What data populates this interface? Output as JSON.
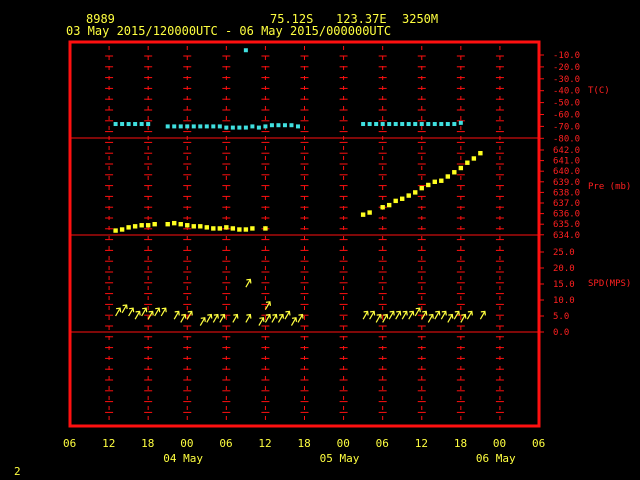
{
  "header": {
    "station_id": "8989",
    "lat": "75.12S",
    "lon": "123.37E",
    "elev": "3250M",
    "time_range": "03 May 2015/120000UTC - 06 May 2015/000000UTC"
  },
  "footer": {
    "page_number": "2"
  },
  "colors": {
    "frame": "#ff1010",
    "grid": "#ff1010",
    "text": "#ffff40",
    "temp": "#40e0e0",
    "pres": "#ffff20",
    "wind": "#ffff40"
  },
  "chart_data": {
    "type": "scatter",
    "x_axis": {
      "unit": "hours since 03 May 2015 00 UTC",
      "range": [
        6,
        78
      ],
      "tick_labels": [
        "06",
        "12",
        "18",
        "00",
        "06",
        "12",
        "18",
        "00",
        "06",
        "12",
        "18",
        "00",
        "06"
      ],
      "date_labels": [
        {
          "label": "04 May",
          "x": 24
        },
        {
          "label": "05 May",
          "x": 48
        },
        {
          "label": "06 May",
          "x": 72
        }
      ]
    },
    "panels": [
      {
        "name": "temperature",
        "label": "T(C)",
        "ticks": [
          "-10.0",
          "-20.0",
          "-30.0",
          "-40.0",
          "-50.0",
          "-60.0",
          "-70.0",
          "-80.0"
        ],
        "range": [
          -85,
          -5
        ],
        "points": [
          [
            13,
            -68
          ],
          [
            14,
            -68
          ],
          [
            15,
            -68
          ],
          [
            16,
            -68
          ],
          [
            17,
            -68
          ],
          [
            18,
            -68
          ],
          [
            21,
            -70
          ],
          [
            22,
            -70
          ],
          [
            23,
            -70
          ],
          [
            24,
            -70
          ],
          [
            25,
            -70
          ],
          [
            26,
            -70
          ],
          [
            27,
            -70
          ],
          [
            28,
            -70
          ],
          [
            29,
            -70
          ],
          [
            30,
            -71
          ],
          [
            31,
            -71
          ],
          [
            32,
            -71
          ],
          [
            33,
            -71
          ],
          [
            34,
            -70
          ],
          [
            35,
            -71
          ],
          [
            36,
            -70
          ],
          [
            37,
            -69
          ],
          [
            38,
            -69
          ],
          [
            39,
            -69
          ],
          [
            40,
            -69
          ],
          [
            41,
            -70
          ],
          [
            33,
            -6
          ],
          [
            51,
            -68
          ],
          [
            52,
            -68
          ],
          [
            53,
            -68
          ],
          [
            54,
            -68
          ],
          [
            55,
            -68
          ],
          [
            56,
            -68
          ],
          [
            57,
            -68
          ],
          [
            58,
            -68
          ],
          [
            59,
            -68
          ],
          [
            60,
            -68
          ],
          [
            61,
            -68
          ],
          [
            62,
            -68
          ],
          [
            63,
            -68
          ],
          [
            64,
            -68
          ],
          [
            65,
            -68
          ],
          [
            66,
            -67
          ]
        ]
      },
      {
        "name": "pressure",
        "label": "Pre (mb)",
        "ticks": [
          "642.0",
          "641.0",
          "640.0",
          "639.0",
          "638.0",
          "637.0",
          "636.0",
          "635.0",
          "634.0"
        ],
        "range": [
          634,
          642
        ],
        "points": [
          [
            13,
            634.4
          ],
          [
            14,
            634.5
          ],
          [
            15,
            634.7
          ],
          [
            16,
            634.8
          ],
          [
            17,
            634.9
          ],
          [
            18,
            634.9
          ],
          [
            19,
            635.0
          ],
          [
            21,
            635.0
          ],
          [
            22,
            635.1
          ],
          [
            23,
            635.0
          ],
          [
            24,
            634.9
          ],
          [
            25,
            634.8
          ],
          [
            26,
            634.8
          ],
          [
            27,
            634.7
          ],
          [
            28,
            634.6
          ],
          [
            29,
            634.6
          ],
          [
            30,
            634.7
          ],
          [
            31,
            634.6
          ],
          [
            32,
            634.5
          ],
          [
            33,
            634.5
          ],
          [
            34,
            634.6
          ],
          [
            36,
            634.6
          ],
          [
            51,
            635.9
          ],
          [
            52,
            636.1
          ],
          [
            54,
            636.6
          ],
          [
            55,
            636.8
          ],
          [
            56,
            637.2
          ],
          [
            57,
            637.4
          ],
          [
            58,
            637.7
          ],
          [
            59,
            638.0
          ],
          [
            60,
            638.4
          ],
          [
            61,
            638.7
          ],
          [
            62,
            639.0
          ],
          [
            63,
            639.1
          ],
          [
            64,
            639.5
          ],
          [
            65,
            639.9
          ],
          [
            66,
            640.3
          ],
          [
            67,
            640.8
          ],
          [
            68,
            641.2
          ],
          [
            69,
            641.7
          ]
        ]
      },
      {
        "name": "wind",
        "label": "SPD(MPS)",
        "ticks": [
          "25.0",
          "20.0",
          "15.0",
          "10.0",
          "5.0",
          "0.0"
        ],
        "range": [
          0,
          26
        ],
        "points": [
          [
            13,
            5
          ],
          [
            14,
            6
          ],
          [
            15,
            5
          ],
          [
            16,
            4
          ],
          [
            17,
            5
          ],
          [
            18,
            4
          ],
          [
            19,
            5
          ],
          [
            20,
            5
          ],
          [
            22,
            4
          ],
          [
            23,
            3
          ],
          [
            24,
            4
          ],
          [
            26,
            2
          ],
          [
            27,
            3
          ],
          [
            28,
            3
          ],
          [
            29,
            3
          ],
          [
            31,
            3
          ],
          [
            33,
            3
          ],
          [
            35,
            2
          ],
          [
            36,
            3
          ],
          [
            37,
            3
          ],
          [
            38,
            3
          ],
          [
            39,
            4
          ],
          [
            40,
            2
          ],
          [
            41,
            3
          ],
          [
            33,
            14
          ],
          [
            36,
            7
          ],
          [
            51,
            4
          ],
          [
            52,
            4
          ],
          [
            53,
            3
          ],
          [
            54,
            3
          ],
          [
            55,
            4
          ],
          [
            56,
            4
          ],
          [
            57,
            4
          ],
          [
            58,
            4
          ],
          [
            59,
            5
          ],
          [
            60,
            4
          ],
          [
            61,
            3
          ],
          [
            62,
            4
          ],
          [
            63,
            4
          ],
          [
            64,
            3
          ],
          [
            65,
            4
          ],
          [
            66,
            3
          ],
          [
            67,
            4
          ],
          [
            69,
            4
          ]
        ]
      }
    ]
  }
}
